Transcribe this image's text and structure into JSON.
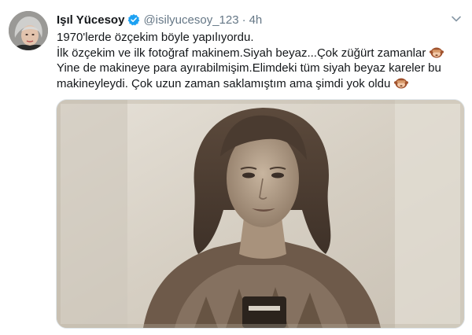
{
  "tweet": {
    "display_name": "Işıl Yücesoy",
    "handle": "@isilyucesoy_123",
    "separator": "·",
    "time": "4h",
    "text_lines": [
      "1970'lerde özçekim böyle yapılıyordu.",
      "İlk özçekim ve ilk fotoğraf makinem.Siyah beyaz...Çok züğürt zamanlar",
      "Yine de makineye para ayırabilmişim.Elimdeki tüm siyah beyaz kareler bu",
      "makineyleydi. Çok uzun zaman saklamıştım ama şimdi yok oldu"
    ],
    "emoji": "see-no-evil-monkey-icon"
  },
  "colors": {
    "text": "#14171a",
    "secondary": "#657786",
    "verified": "#1da1f2",
    "border": "#e1e8ed",
    "photo_tone": "#d7d0c4"
  }
}
